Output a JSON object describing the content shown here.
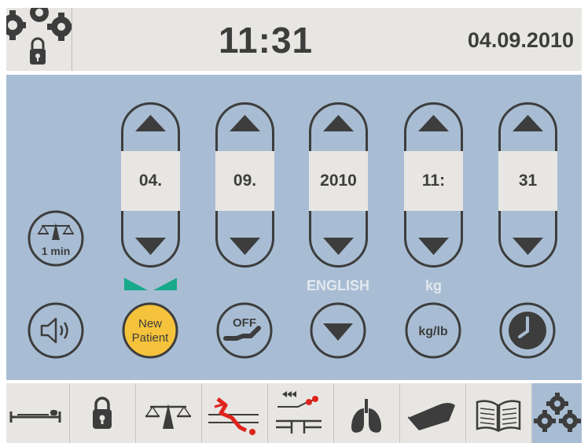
{
  "header": {
    "time": "11:31",
    "date": "04.09.2010",
    "settings_icon": "gears-lock-icon"
  },
  "spinners": [
    {
      "name": "day",
      "value": "04."
    },
    {
      "name": "month",
      "value": "09."
    },
    {
      "name": "year",
      "value": "2010"
    },
    {
      "name": "hour",
      "value": "11:"
    },
    {
      "name": "minute",
      "value": "31"
    }
  ],
  "left_buttons": {
    "scale_time_label": "1 min",
    "scale_time_icon": "scale-icon",
    "sound_icon": "speaker-icon"
  },
  "bottom_buttons": {
    "new_patient_line1": "New",
    "new_patient_line2": "Patient",
    "off_label": "OFF",
    "language_caption": "ENGLISH",
    "unit_caption": "kg",
    "unit_toggle_label": "kg/lb",
    "clock_icon": "clock-icon"
  },
  "colors": {
    "background_panel": "#a8bdd3",
    "header_bg": "#e8e6e2",
    "text": "#3d3d3d",
    "new_patient_yellow": "#f5c33b",
    "indicator_teal": "#18a88a",
    "accent_red": "#e0241c"
  },
  "footer_tabs": [
    {
      "icon": "bed-patient-icon",
      "active": false
    },
    {
      "icon": "padlock-icon",
      "active": false
    },
    {
      "icon": "scale-icon",
      "active": false
    },
    {
      "icon": "bed-position-red-icon",
      "active": false
    },
    {
      "icon": "bed-exit-icon",
      "active": false
    },
    {
      "icon": "lungs-icon",
      "active": false
    },
    {
      "icon": "mattress-icon",
      "active": false
    },
    {
      "icon": "book-icon",
      "active": false
    },
    {
      "icon": "gears-icon",
      "active": true
    }
  ]
}
